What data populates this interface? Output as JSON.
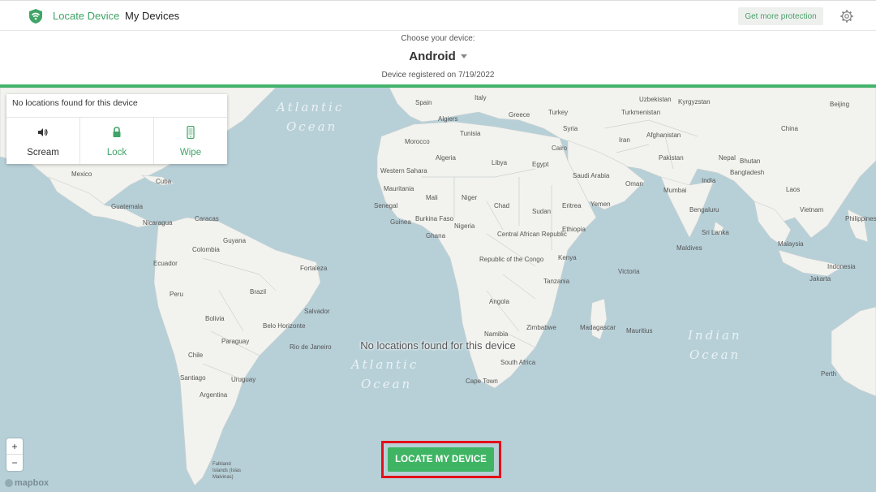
{
  "nav": {
    "locate_label": "Locate Device",
    "devices_label": "My Devices",
    "protect_label": "Get more protection"
  },
  "device": {
    "choose_label": "Choose your device:",
    "name": "Android",
    "registered": "Device registered on 7/19/2022"
  },
  "card": {
    "title": "No locations found for this device",
    "actions": [
      {
        "label": "Scream",
        "icon": "speaker-icon"
      },
      {
        "label": "Lock",
        "icon": "lock-icon"
      },
      {
        "label": "Wipe",
        "icon": "phone-icon"
      }
    ]
  },
  "map": {
    "message": "No locations found for this device",
    "oceans": [
      "Atlantic",
      "Ocean",
      "Atlantic",
      "Ocean",
      "Indian",
      "Ocean"
    ],
    "places": [
      "Spain",
      "Italy",
      "Greece",
      "Turkey",
      "Uzbekistan",
      "Kyrgyzstan",
      "Turkmenistan",
      "Beijing",
      "Algiers",
      "Tunisia",
      "Syria",
      "Afghanistan",
      "China",
      "Morocco",
      "Iran",
      "Algeria",
      "Libya",
      "Egypt",
      "Cairo",
      "Pakistan",
      "Nepal",
      "Bhutan",
      "Saudi Arabia",
      "Western Sahara",
      "Bangladesh",
      "Mauritania",
      "Mali",
      "Niger",
      "Oman",
      "India",
      "Mexico",
      "Cuba",
      "Senegal",
      "Chad",
      "Sudan",
      "Eritrea",
      "Yemen",
      "Mumbai",
      "Laos",
      "Guinea",
      "Burkina Faso",
      "Nigeria",
      "Guatemala",
      "Nicaragua",
      "Caracas",
      "Ghana",
      "Central African Republic",
      "Ethiopia",
      "Bengaluru",
      "Vietnam",
      "Philippines",
      "Guyana",
      "Colombia",
      "Sri Lanka",
      "Malaysia",
      "Ecuador",
      "Republic of the Congo",
      "Kenya",
      "Maldives",
      "Fortaleza",
      "Victoria",
      "Indonesia",
      "Peru",
      "Brazil",
      "Tanzania",
      "Jakarta",
      "Angola",
      "Salvador",
      "Bolivia",
      "Belo Horizonte",
      "Namibia",
      "Zimbabwe",
      "Madagascar",
      "Mauritius",
      "Paraguay",
      "Rio de Janeiro",
      "Chile",
      "South Africa",
      "Santiago",
      "Uruguay",
      "Cape Town",
      "Argentina",
      "Perth",
      "Falkland Islands (Islas Malvinas)"
    ]
  },
  "zoom": {
    "in": "+",
    "out": "−"
  },
  "attribution": "mapbox",
  "locate_button": "LOCATE MY DEVICE",
  "colors": {
    "accent": "#3fa466",
    "button": "#3fb564",
    "highlight": "#e3101a",
    "water": "#b7d0d8",
    "land": "#f2f2ee"
  }
}
